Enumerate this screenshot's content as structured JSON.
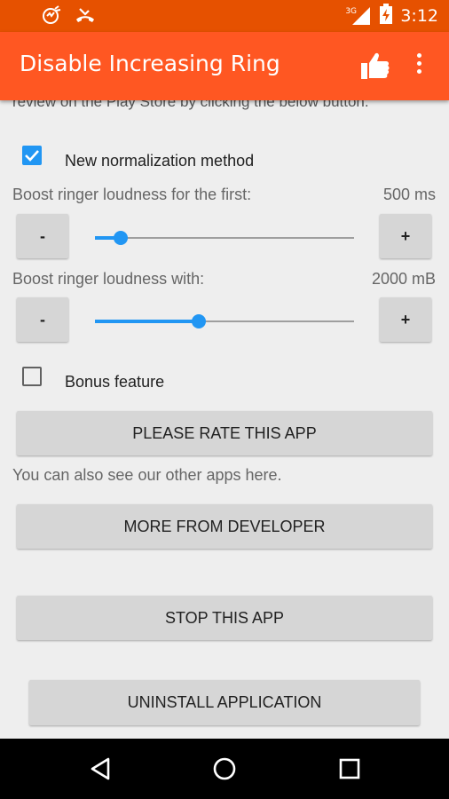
{
  "status_bar": {
    "time": "3:12",
    "network": "3G",
    "icons": [
      "app-notification-icon",
      "missed-call-icon",
      "signal-icon",
      "battery-charging-icon"
    ]
  },
  "app_bar": {
    "title": "Disable Increasing Ring",
    "actions": [
      "thumbs-up-icon",
      "overflow-menu-icon"
    ]
  },
  "content": {
    "truncated_text": "review on the Play Store by clicking the below button.",
    "normalization": {
      "label": "New normalization method",
      "checked": true
    },
    "boost_first": {
      "label": "Boost ringer loudness for the first:",
      "value": "500 ms",
      "minus_label": "-",
      "plus_label": "+",
      "level": 0.1
    },
    "boost_with": {
      "label": "Boost ringer loudness with:",
      "value": "2000 mB",
      "minus_label": "-",
      "plus_label": "+",
      "level": 0.4
    },
    "bonus": {
      "label": "Bonus feature",
      "checked": false
    },
    "rate_button": "PLEASE RATE THIS APP",
    "other_apps_text": "You can also see our other apps here.",
    "more_button": "MORE FROM DEVELOPER",
    "stop_button": "STOP THIS APP",
    "uninstall_button": "UNINSTALL APPLICATION"
  },
  "nav_bar": {
    "icons": [
      "back-icon",
      "home-icon",
      "recents-icon"
    ]
  },
  "colors": {
    "status_bar": "#e65100",
    "app_bar": "#ff5722",
    "accent": "#2196f3",
    "background": "#eeeeee",
    "button": "#d6d6d6"
  }
}
